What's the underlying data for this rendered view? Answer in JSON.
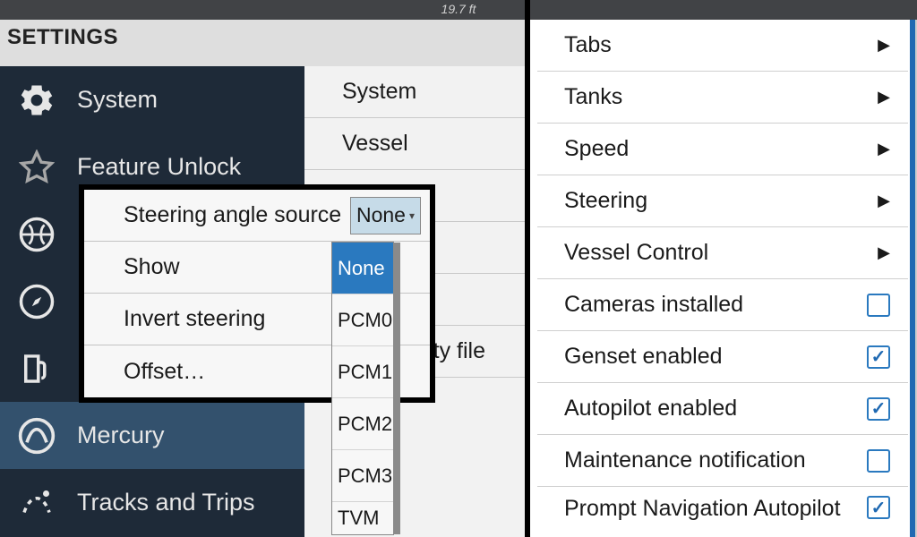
{
  "statusbar": {
    "depth": "19.7 ft"
  },
  "settings_title": "SETTINGS",
  "sidebar": {
    "items": [
      {
        "icon": "gear-icon",
        "label": "System"
      },
      {
        "icon": "star-icon",
        "label": "Feature Unlock"
      },
      {
        "icon": "chart-icon",
        "label": ""
      },
      {
        "icon": "compass-icon",
        "label": ""
      },
      {
        "icon": "fuel-icon",
        "label": ""
      },
      {
        "icon": "mercury-icon",
        "label": "Mercury"
      },
      {
        "icon": "tracks-icon",
        "label": "Tracks and Trips"
      }
    ],
    "selected_index": 5
  },
  "middle_list": {
    "items": [
      "System",
      "Vessel",
      "",
      "",
      "",
      "Personality file"
    ],
    "partial_visible": "ty file"
  },
  "steering_popup": {
    "rows": [
      {
        "label": "Steering angle source",
        "value": "None"
      },
      {
        "label": "Show"
      },
      {
        "label": "Invert steering"
      },
      {
        "label": "Offset…"
      }
    ]
  },
  "dropdown": {
    "options": [
      "None",
      "PCM0",
      "PCM1",
      "PCM2",
      "PCM3",
      "TVM"
    ],
    "selected_index": 0
  },
  "right_panel": {
    "items": [
      {
        "label": "Tabs",
        "type": "nav"
      },
      {
        "label": "Tanks",
        "type": "nav"
      },
      {
        "label": "Speed",
        "type": "nav"
      },
      {
        "label": "Steering",
        "type": "nav"
      },
      {
        "label": "Vessel Control",
        "type": "nav"
      },
      {
        "label": "Cameras installed",
        "type": "check",
        "checked": false
      },
      {
        "label": "Genset enabled",
        "type": "check",
        "checked": true
      },
      {
        "label": "Autopilot enabled",
        "type": "check",
        "checked": true
      },
      {
        "label": "Maintenance notification",
        "type": "check",
        "checked": false
      },
      {
        "label": "Prompt Navigation Autopilot",
        "type": "check",
        "checked": true,
        "partial": true
      }
    ]
  }
}
